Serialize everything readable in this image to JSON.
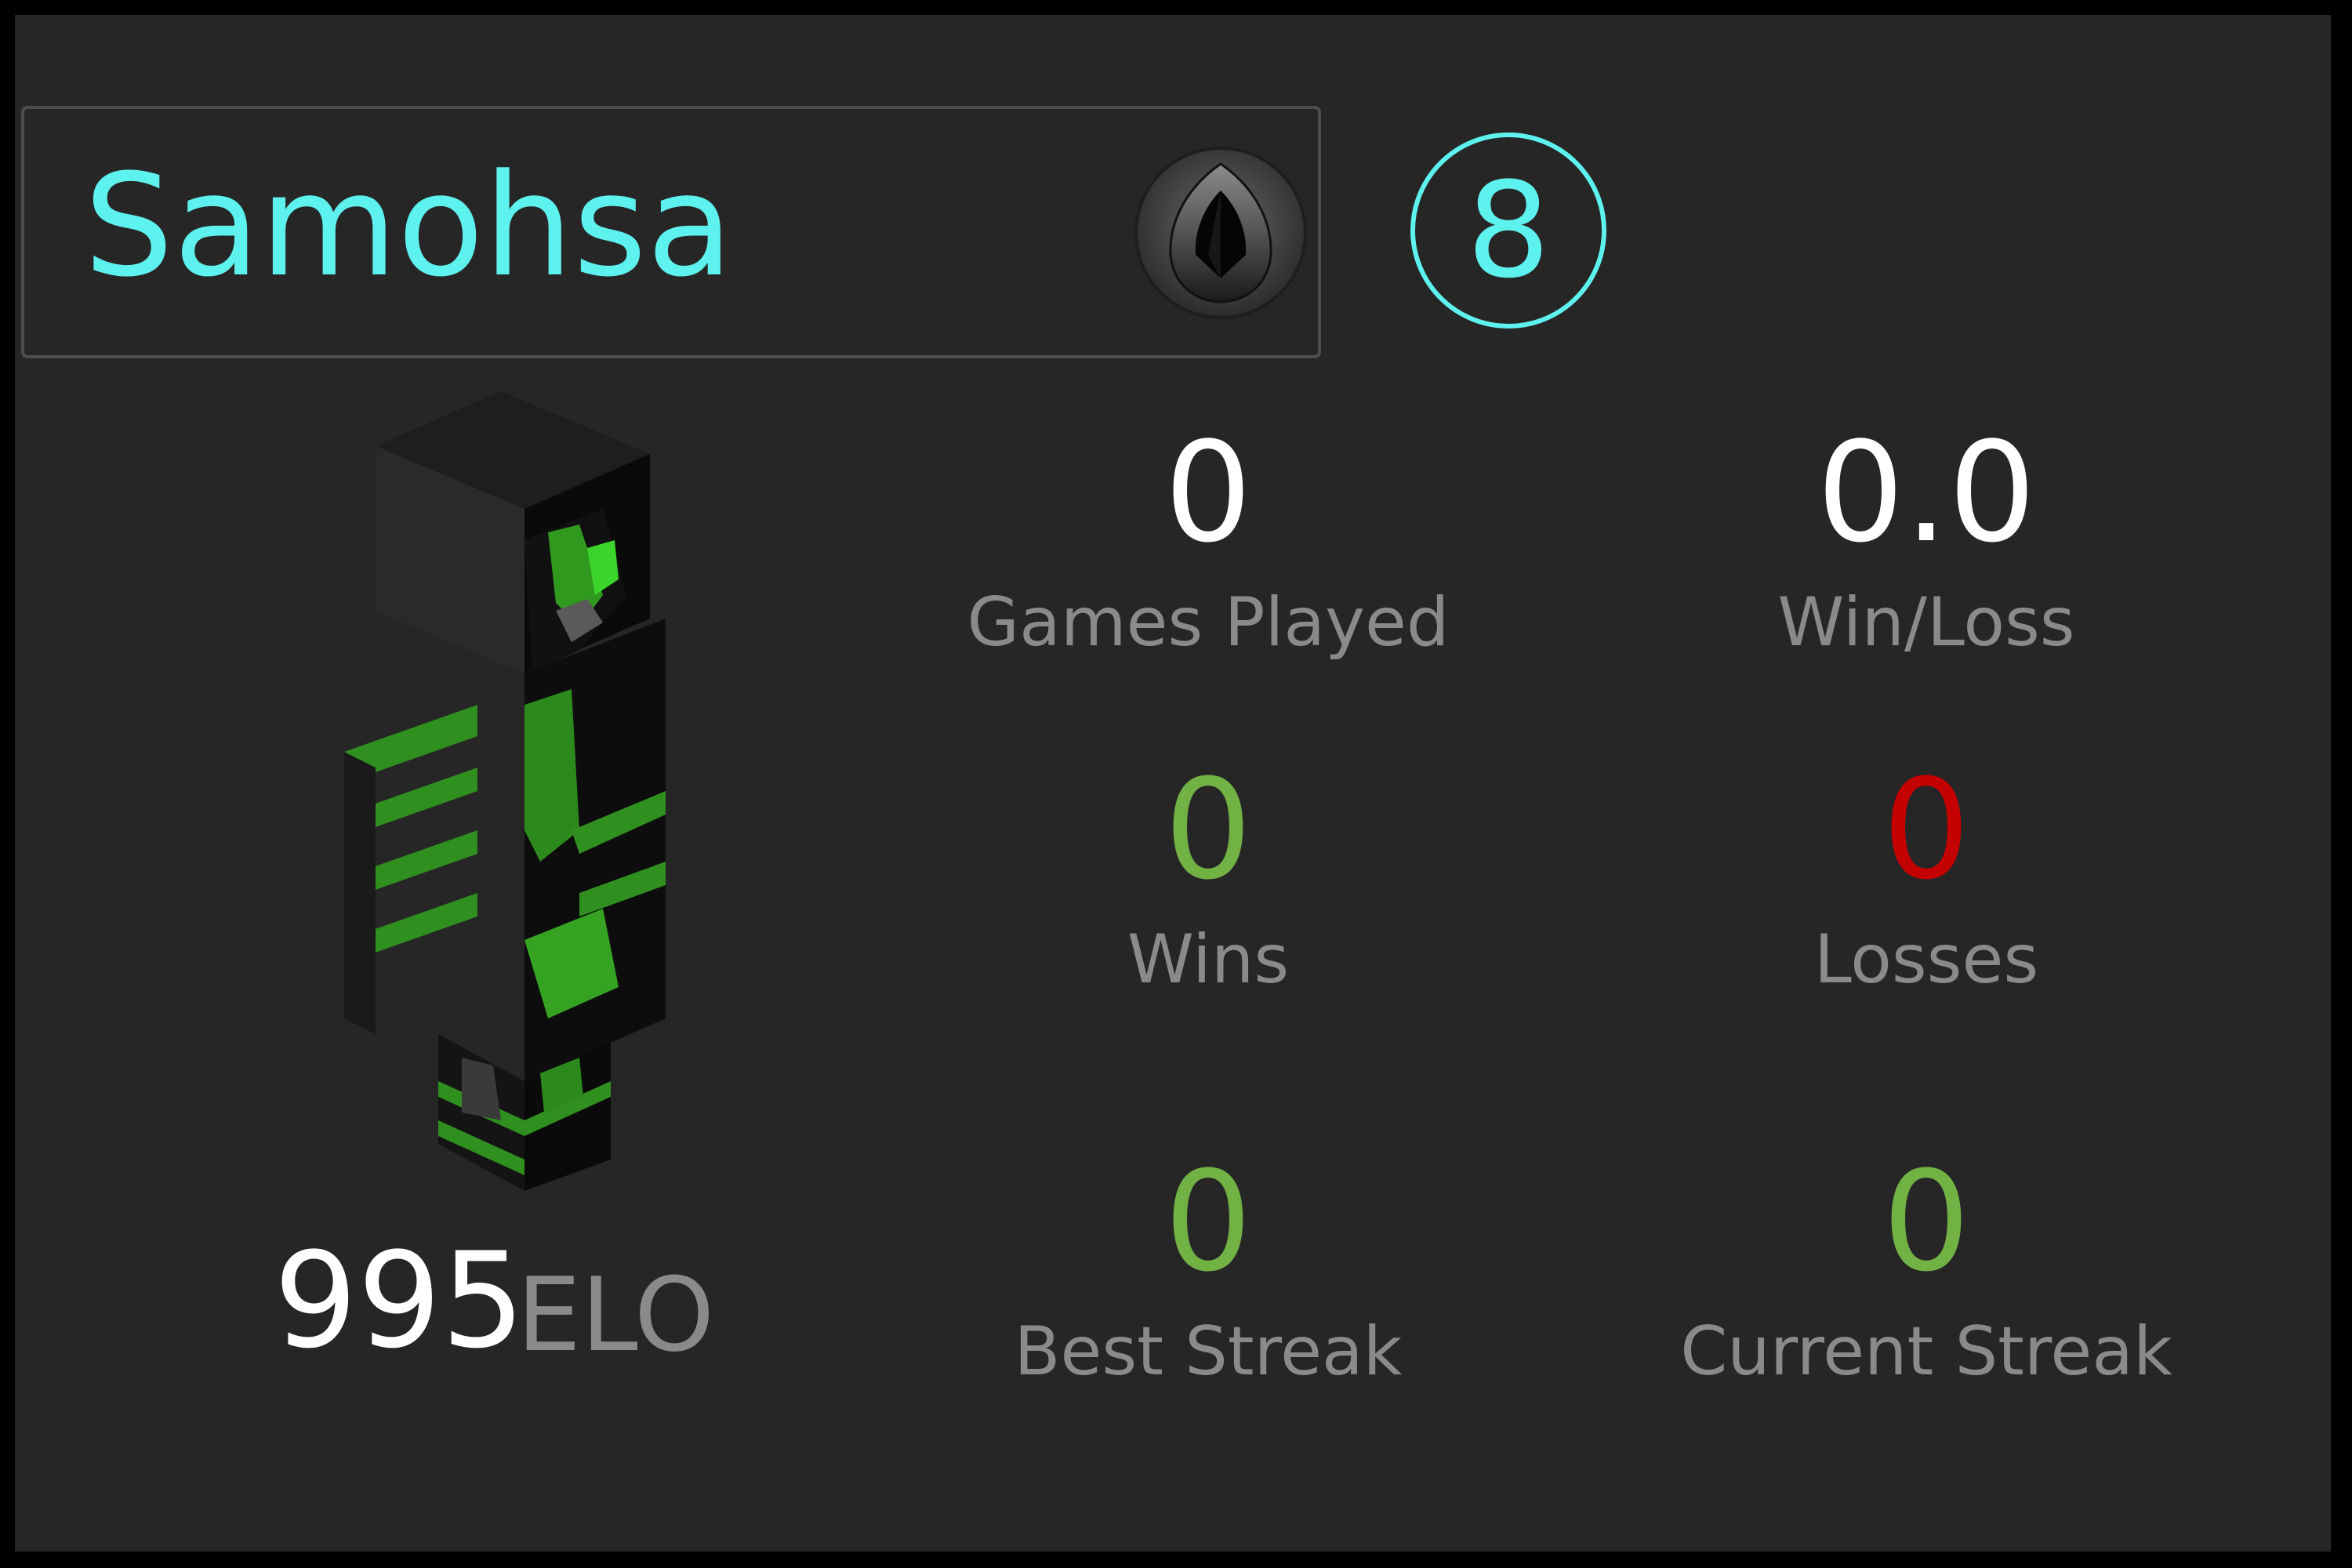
{
  "player": {
    "name": "Samohsa",
    "level": "8",
    "elo_value": "995",
    "elo_label": "ELO"
  },
  "rank": {
    "icon": "black-gem-rank-icon"
  },
  "stats": {
    "games_played": {
      "value": "0",
      "label": "Games Played"
    },
    "win_loss": {
      "value": "0.0",
      "label": "Win/Loss"
    },
    "wins": {
      "value": "0",
      "label": "Wins"
    },
    "losses": {
      "value": "0",
      "label": "Losses"
    },
    "best_streak": {
      "value": "0",
      "label": "Best Streak"
    },
    "current_streak": {
      "value": "0",
      "label": "Current Streak"
    }
  },
  "colors": {
    "accent": "#5ef2ef",
    "background": "#262626",
    "positive": "#72b244",
    "negative": "#c40000",
    "muted_text": "#8a8a8a"
  }
}
